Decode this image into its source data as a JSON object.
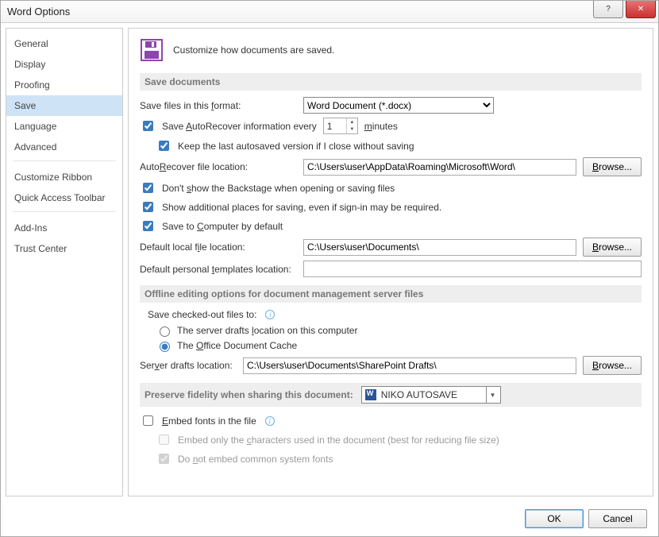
{
  "window": {
    "title": "Word Options"
  },
  "sidebar": {
    "items": [
      {
        "label": "General"
      },
      {
        "label": "Display"
      },
      {
        "label": "Proofing"
      },
      {
        "label": "Save",
        "selected": true
      },
      {
        "label": "Language"
      },
      {
        "label": "Advanced"
      },
      {
        "label": "Customize Ribbon",
        "sep": true
      },
      {
        "label": "Quick Access Toolbar"
      },
      {
        "label": "Add-Ins",
        "sep": true
      },
      {
        "label": "Trust Center"
      }
    ]
  },
  "header_text": "Customize how documents are saved.",
  "sections": {
    "save_docs": {
      "title": "Save documents",
      "format_label": "Save files in this format:",
      "format_value": "Word Document (*.docx)",
      "autorecover_label_pre": "Save ",
      "autorecover_label_mid": "utoRecover information every",
      "autorecover_minutes": "1",
      "minutes_label": "minutes",
      "keep_last_label": "Keep the last autosaved version if I close without saving",
      "ar_location_label": "AutoRecover file location:",
      "ar_location_value": "C:\\Users\\user\\AppData\\Roaming\\Microsoft\\Word\\",
      "browse": "Browse...",
      "dont_show_label": "Don't show the Backstage when opening or saving files",
      "additional_places_label": "Show additional places for saving, even if sign-in may be required.",
      "save_computer_label": "Save to Computer by default",
      "default_local_label": "Default local file location:",
      "default_local_value": "C:\\Users\\user\\Documents\\",
      "default_templates_label": "Default personal templates location:",
      "default_templates_value": ""
    },
    "offline": {
      "title": "Offline editing options for document management server files",
      "checked_out_label": "Save checked-out files to:",
      "radio_server": "The server drafts location on this computer",
      "radio_cache_pre": "The ",
      "radio_cache_post": "ffice Document Cache",
      "server_drafts_label": "Server drafts location:",
      "server_drafts_value": "C:\\Users\\user\\Documents\\SharePoint Drafts\\"
    },
    "preserve": {
      "title": "Preserve fidelity when sharing this document:",
      "doc_name": "NIKO AUTOSAVE",
      "embed_label": "Embed fonts in the file",
      "embed_only_label": "Embed only the characters used in the document (best for reducing file size)",
      "do_not_embed_label": "Do not embed common system fonts"
    }
  },
  "footer": {
    "ok": "OK",
    "cancel": "Cancel"
  }
}
